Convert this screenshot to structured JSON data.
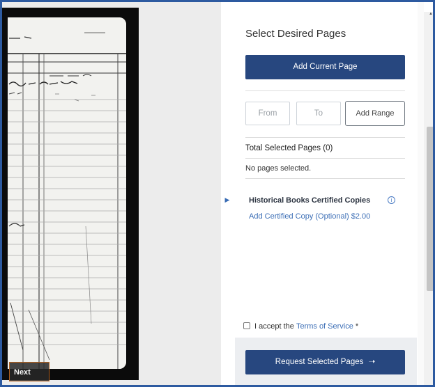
{
  "viewer": {
    "next_label": "Next"
  },
  "panel": {
    "title": "Select Desired Pages",
    "add_current_label": "Add Current Page",
    "from_placeholder": "From",
    "to_placeholder": "To",
    "add_range_label": "Add Range",
    "total_label": "Total Selected Pages (0)",
    "empty_message": "No pages selected.",
    "certified_title": "Historical Books Certified Copies",
    "certified_link": "Add Certified Copy (Optional) $2.00",
    "tos_prefix": "I accept the",
    "tos_link": "Terms of Service",
    "tos_required": " *",
    "request_label": "Request Selected Pages"
  },
  "icons": {
    "info": "info-icon",
    "collapse": "triangle-right-icon",
    "request_arrow": "arrow-right-icon"
  },
  "colors": {
    "primary": "#27477f",
    "link": "#3d6fb6",
    "frame_border": "#2d5aa0"
  }
}
